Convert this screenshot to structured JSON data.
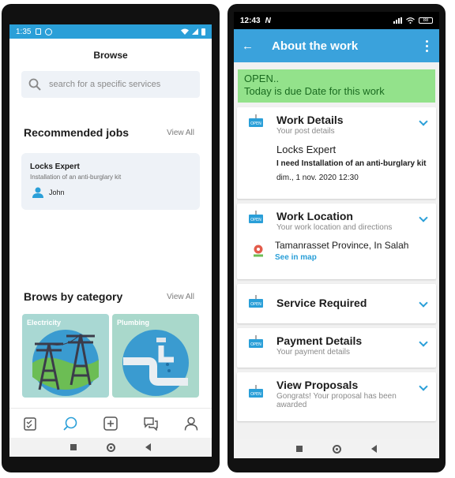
{
  "left": {
    "status": {
      "time": "1:35"
    },
    "title": "Browse",
    "search": {
      "placeholder": "search for a specific services"
    },
    "recommended": {
      "title": "Recommended jobs",
      "view_all": "View All",
      "job": {
        "title": "Locks Expert",
        "description": "Installation of an anti-burglary kit",
        "user": "John"
      }
    },
    "categories": {
      "title": "Brows by category",
      "view_all": "View All",
      "items": [
        {
          "label": "Electricity"
        },
        {
          "label": "Plumbing"
        }
      ]
    },
    "nav": [
      "tasks-icon",
      "chat-search-icon",
      "add-icon",
      "messages-icon",
      "profile-icon"
    ],
    "accent": "#2a9fd8"
  },
  "right": {
    "status": {
      "time": "12:43",
      "logo": "N",
      "battery": "88"
    },
    "appbar": {
      "title": "About the work"
    },
    "banner": {
      "line1": "OPEN..",
      "line2": "Today is due Date for this work",
      "color": "#93e28b"
    },
    "work_details": {
      "title": "Work Details",
      "subtitle": "Your post details",
      "job_title": "Locks Expert",
      "job_description": "I need Installation of an anti-burglary kit",
      "date": "dim., 1 nov. 2020 12:30"
    },
    "work_location": {
      "title": "Work Location",
      "subtitle": "Your work location and directions",
      "location": "Tamanrasset Province, In Salah",
      "map_link": "See in map"
    },
    "service_required": {
      "title": "Service Required"
    },
    "payment_details": {
      "title": "Payment Details",
      "subtitle": "Your payment details"
    },
    "view_proposals": {
      "title": "View Proposals",
      "subtitle": "Gongrats! Your proposal has been awarded"
    },
    "appbar_color": "#3aa2dc"
  }
}
